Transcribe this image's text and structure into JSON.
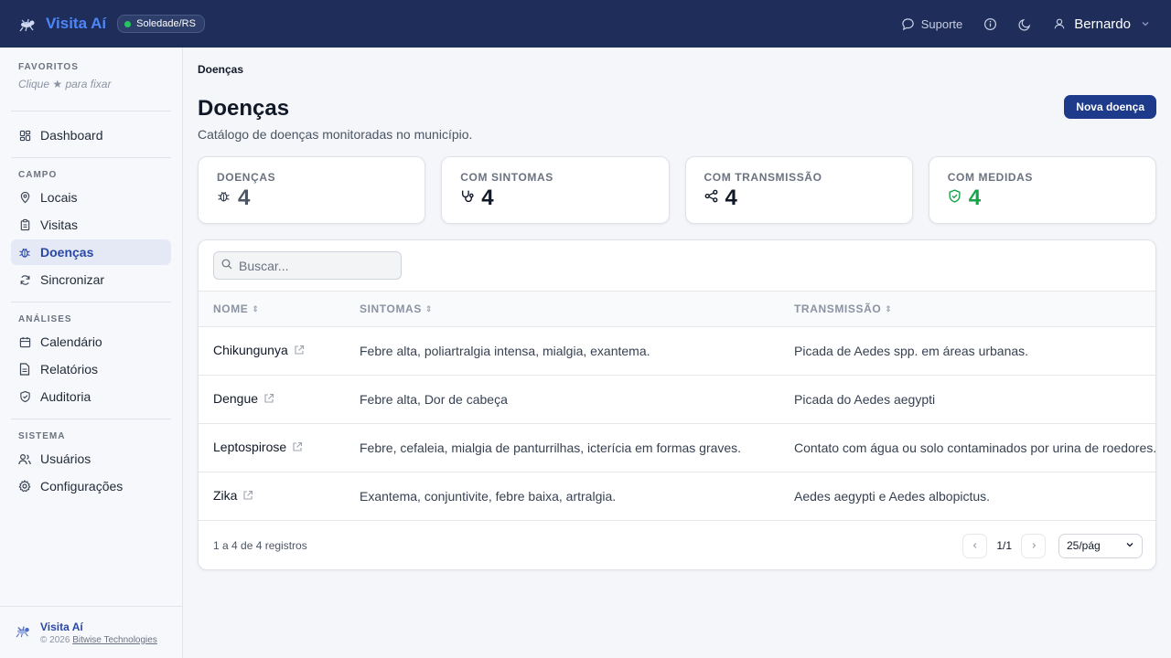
{
  "header": {
    "app_name": "Visita Aí",
    "city": "Soledade/RS",
    "support_label": "Suporte",
    "user_name": "Bernardo"
  },
  "sidebar": {
    "favorites": {
      "label": "FAVORITOS",
      "hint": "Clique ★ para fixar"
    },
    "dashboard": "Dashboard",
    "sections": [
      {
        "label": "CAMPO",
        "items": [
          "Locais",
          "Visitas",
          "Doenças",
          "Sincronizar"
        ]
      },
      {
        "label": "ANÁLISES",
        "items": [
          "Calendário",
          "Relatórios",
          "Auditoria"
        ]
      },
      {
        "label": "SISTEMA",
        "items": [
          "Usuários",
          "Configurações"
        ]
      }
    ],
    "active_item": "Doenças",
    "footer": {
      "name": "Visita Aí",
      "copyright": "© 2026",
      "company": "Bitwise Technologies"
    }
  },
  "main": {
    "breadcrumb": "Doenças",
    "title": "Doenças",
    "subtitle": "Catálogo de doenças monitoradas no município.",
    "new_button": "Nova doença",
    "stats": [
      {
        "label": "DOENÇAS",
        "value": "4",
        "icon": "bug-icon",
        "color": "#374151"
      },
      {
        "label": "COM SINTOMAS",
        "value": "4",
        "icon": "stethoscope-icon",
        "color": "#111827"
      },
      {
        "label": "COM TRANSMISSÃO",
        "value": "4",
        "icon": "share-icon",
        "color": "#111827"
      },
      {
        "label": "COM MEDIDAS",
        "value": "4",
        "icon": "shield-check-icon",
        "color": "#16a34a"
      }
    ],
    "search_placeholder": "Buscar...",
    "table": {
      "columns": [
        "NOME",
        "SINTOMAS",
        "TRANSMISSÃO"
      ],
      "rows": [
        {
          "name": "Chikungunya",
          "symptoms": "Febre alta, poliartralgia intensa, mialgia, exantema.",
          "transmission": "Picada de Aedes spp. em áreas urbanas."
        },
        {
          "name": "Dengue",
          "symptoms": "Febre alta, Dor de cabeça",
          "transmission": "Picada do Aedes aegypti"
        },
        {
          "name": "Leptospirose",
          "symptoms": "Febre, cefaleia, mialgia de panturrilhas, icterícia em formas graves.",
          "transmission": "Contato com água ou solo contaminados por urina de roedores."
        },
        {
          "name": "Zika",
          "symptoms": "Exantema, conjuntivite, febre baixa, artralgia.",
          "transmission": "Aedes aegypti e Aedes albopictus."
        }
      ]
    },
    "pagination": {
      "records": "1 a 4 de 4 registros",
      "page": "1/1",
      "per_page": "25/pág"
    }
  }
}
